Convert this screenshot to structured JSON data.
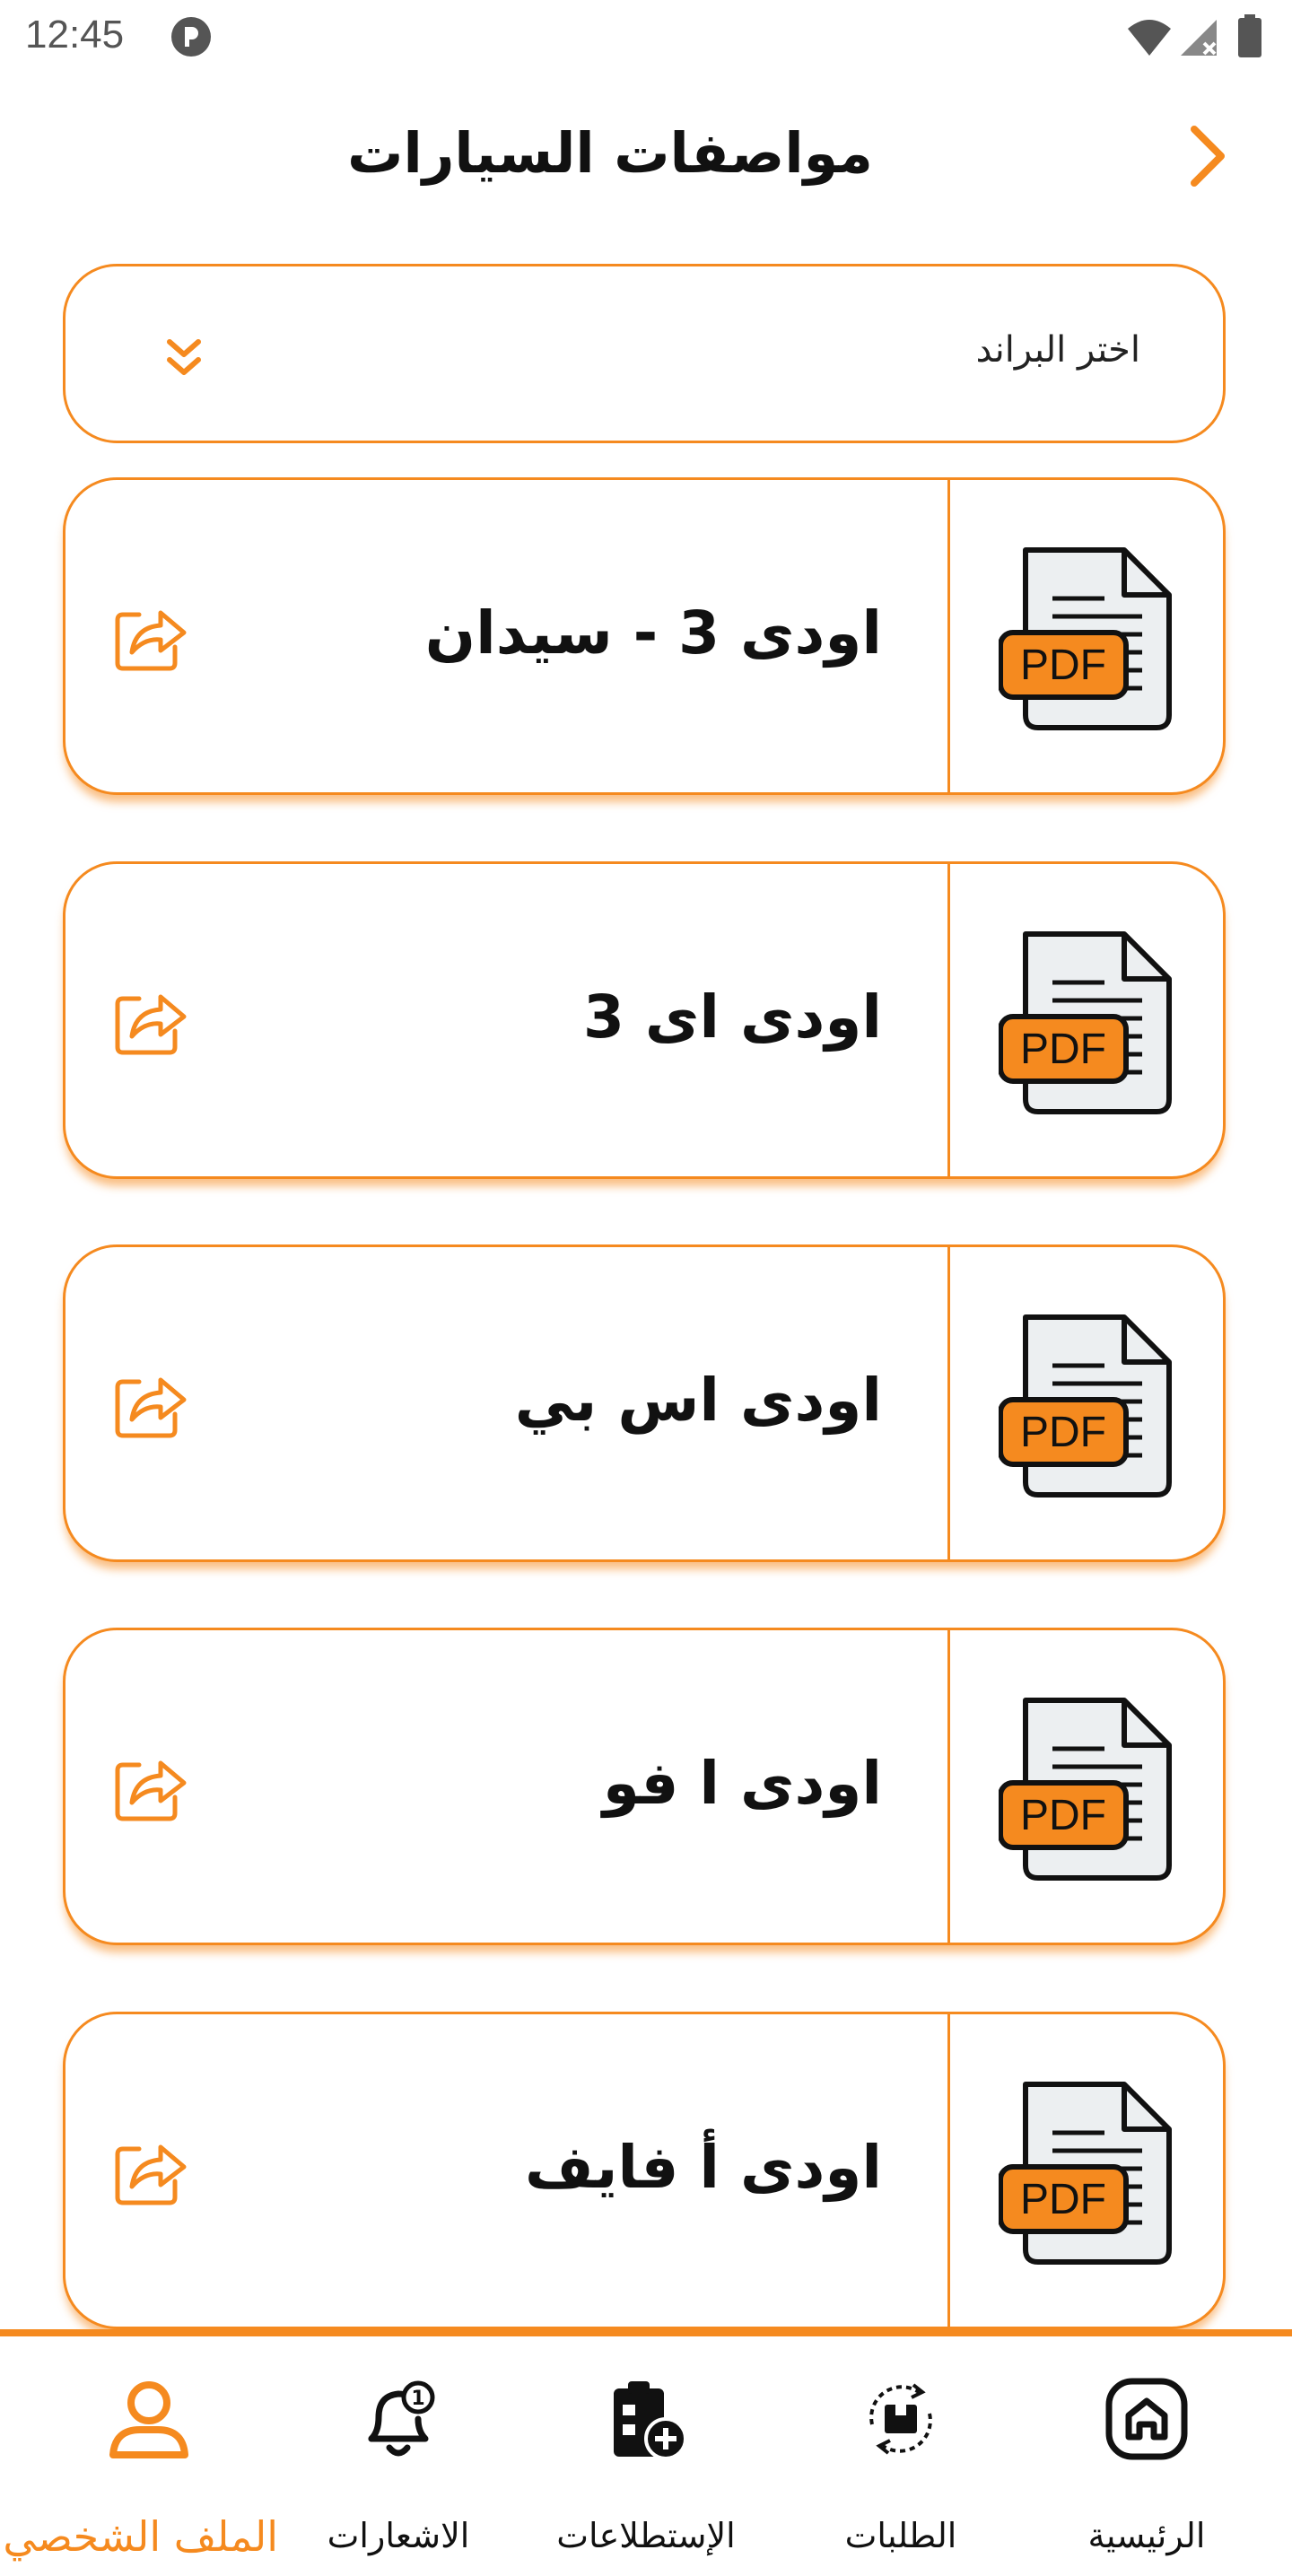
{
  "status_bar": {
    "time": "12:45"
  },
  "header": {
    "title": "مواصفات السيارات"
  },
  "brand_select": {
    "selected": "اختر البراند"
  },
  "cards": [
    {
      "title": "اودى 3 - سيدان"
    },
    {
      "title": "اودى اى 3"
    },
    {
      "title": "اودى اس بي"
    },
    {
      "title": "اودى ا فو"
    },
    {
      "title": "اودى أ فايف"
    }
  ],
  "pdf_badge": "PDF",
  "nav": {
    "home": "الرئيسية",
    "orders": "الطلبات",
    "surveys": "الإستطلاعات",
    "notifications": "الاشعارات",
    "profile": "الملف الشخصي",
    "notification_count": "1"
  },
  "colors": {
    "accent": "#F58A1F",
    "text": "#111111",
    "pdf_page": "#ECEFF1"
  },
  "icons": {
    "back": "chevron-right-icon",
    "dropdown": "double-chevron-down-icon",
    "file": "pdf-file-icon",
    "share": "share-icon",
    "home": "home-icon",
    "orders": "orders-cycle-icon",
    "surveys": "clipboard-add-icon",
    "notifications": "bell-icon",
    "profile": "user-icon"
  }
}
